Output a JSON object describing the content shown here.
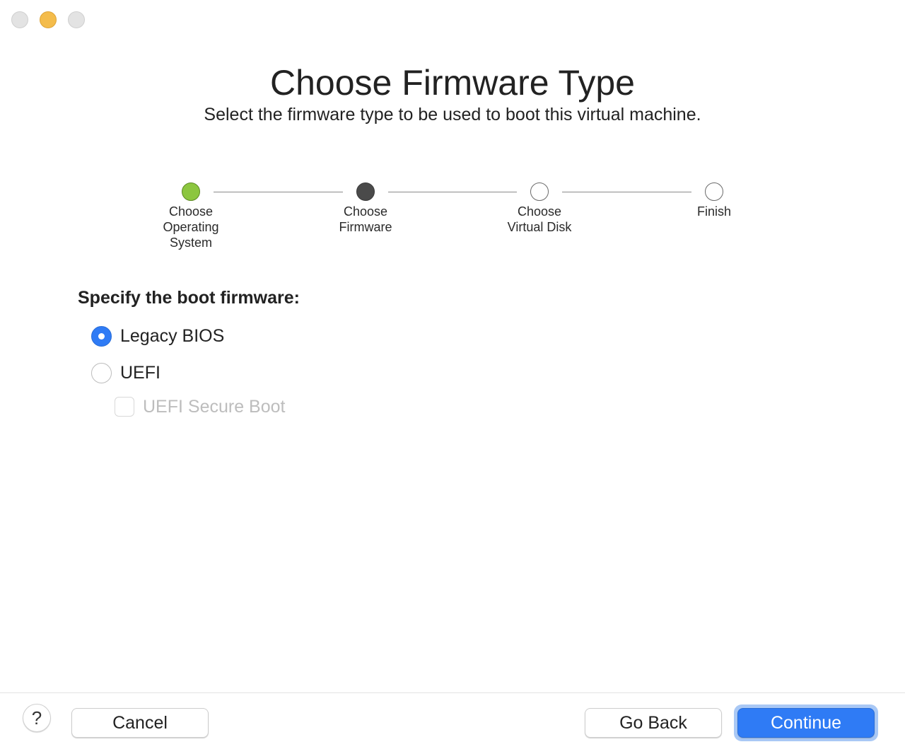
{
  "window": {
    "controls": [
      "close-icon",
      "minimize-icon",
      "zoom-icon"
    ]
  },
  "header": {
    "title": "Choose Firmware Type",
    "subtitle": "Select the firmware type to be used to boot this virtual machine."
  },
  "steps": [
    {
      "label": "Choose\nOperating\nSystem",
      "state": "done"
    },
    {
      "label": "Choose\nFirmware",
      "state": "current"
    },
    {
      "label": "Choose\nVirtual Disk",
      "state": "pending"
    },
    {
      "label": "Finish",
      "state": "pending"
    }
  ],
  "firmware": {
    "section_label": "Specify the boot firmware:",
    "options": [
      {
        "label": "Legacy BIOS",
        "checked": true
      },
      {
        "label": "UEFI",
        "checked": false
      }
    ],
    "secure_boot": {
      "label": "UEFI Secure Boot",
      "checked": false,
      "enabled": false
    }
  },
  "footer": {
    "help_label": "?",
    "cancel_label": "Cancel",
    "go_back_label": "Go Back",
    "continue_label": "Continue"
  },
  "colors": {
    "accent": "#2f7bf5",
    "step_done": "#8cc63f",
    "step_current": "#4a4a4a",
    "minimize": "#f4bc4b"
  }
}
